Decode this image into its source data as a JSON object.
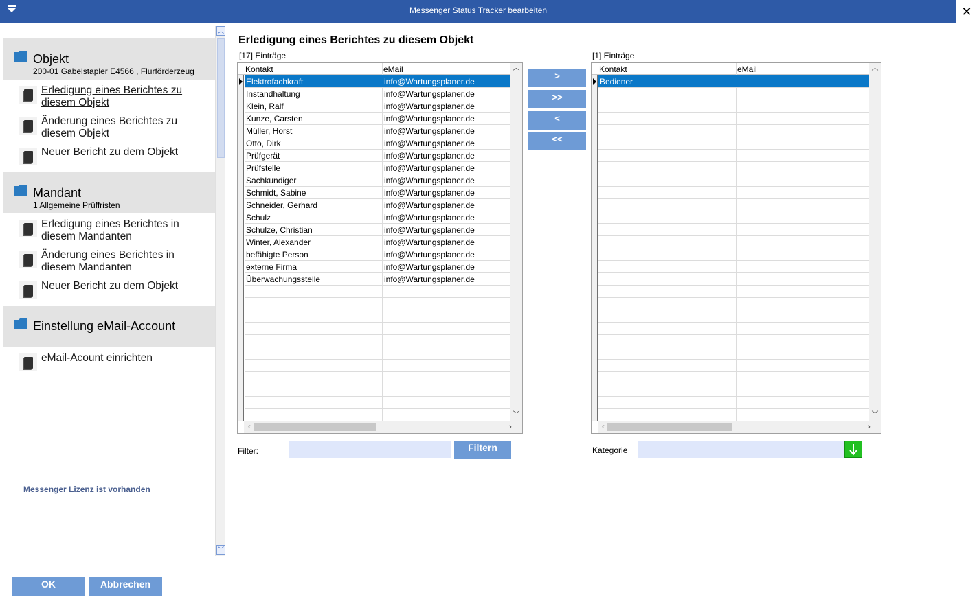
{
  "window": {
    "title": "Messenger Status Tracker bearbeiten",
    "close_glyph": "✕"
  },
  "nav": {
    "sections": [
      {
        "title": "Objekt",
        "subtitle": "200-01 Gabelstapler E4566 , Flurförderzeug",
        "items": [
          "Erledigung eines Berichtes zu diesem Objekt",
          "Änderung eines Berichtes zu diesem Objekt",
          "Neuer Bericht zu dem Objekt"
        ]
      },
      {
        "title": "Mandant",
        "subtitle": "1 Allgemeine Prüffristen",
        "items": [
          "Erledigung  eines Berichtes in diesem Mandanten",
          "Änderung eines Berichtes in diesem Mandanten",
          "Neuer Bericht zu dem Objekt"
        ]
      },
      {
        "title": "Einstellung eMail-Account",
        "subtitle": "",
        "items": [
          "eMail-Acount einrichten"
        ]
      }
    ],
    "license_text": "Messenger Lizenz ist vorhanden"
  },
  "main": {
    "title": "Erledigung eines Berichtes zu diesem Objekt",
    "left_list": {
      "count_label": "[17] Einträge",
      "columns": [
        "Kontakt",
        "eMail"
      ],
      "rows": [
        [
          "Elektrofachkraft",
          "info@Wartungsplaner.de"
        ],
        [
          "Instandhaltung",
          "info@Wartungsplaner.de"
        ],
        [
          "Klein, Ralf",
          "info@Wartungsplaner.de"
        ],
        [
          "Kunze, Carsten",
          "info@Wartungsplaner.de"
        ],
        [
          "Müller, Horst",
          "info@Wartungsplaner.de"
        ],
        [
          "Otto, Dirk",
          "info@Wartungsplaner.de"
        ],
        [
          "Prüfgerät",
          "info@Wartungsplaner.de"
        ],
        [
          "Prüfstelle",
          "info@Wartungsplaner.de"
        ],
        [
          "Sachkundiger",
          "info@Wartungsplaner.de"
        ],
        [
          "Schmidt, Sabine",
          "info@Wartungsplaner.de"
        ],
        [
          "Schneider, Gerhard",
          "info@Wartungsplaner.de"
        ],
        [
          "Schulz",
          "info@Wartungsplaner.de"
        ],
        [
          "Schulze, Christian",
          "info@Wartungsplaner.de"
        ],
        [
          "Winter, Alexander",
          "info@Wartungsplaner.de"
        ],
        [
          "befähigte Person",
          "info@Wartungsplaner.de"
        ],
        [
          "externe Firma",
          "info@Wartungsplaner.de"
        ],
        [
          "Überwachungsstelle",
          "info@Wartungsplaner.de"
        ]
      ],
      "selected_index": 0
    },
    "right_list": {
      "count_label": "[1] Einträge",
      "columns": [
        "Kontakt",
        "eMail"
      ],
      "rows": [
        [
          "Bediener",
          ""
        ]
      ],
      "selected_index": 0
    },
    "move_buttons": [
      ">",
      ">>",
      "<",
      "<<"
    ],
    "filter": {
      "label": "Filter:",
      "value": "",
      "button": "Filtern"
    },
    "category": {
      "label": "Kategorie",
      "value": ""
    }
  },
  "footer": {
    "ok": "OK",
    "cancel": "Abbrechen"
  },
  "colors": {
    "titlebar": "#2e5aa7",
    "selection": "#0a78c8",
    "button": "#6e9bd6",
    "green": "#22c022"
  }
}
